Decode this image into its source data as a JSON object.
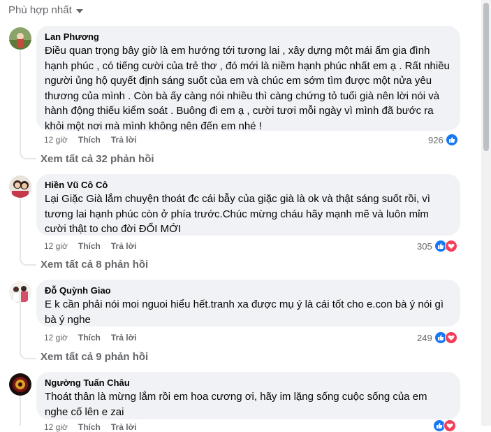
{
  "sort": {
    "label": "Phù hợp nhất"
  },
  "comments": [
    {
      "name": "Lan Phương",
      "text": "Điều quan trọng bây giờ là em hướng tới tương lai , xây dựng một mái ấm gia đình hạnh phúc , có tiếng cười của trẻ thơ , đó mới là niềm hạnh phúc nhất em ạ . Rất nhiều người ủng hộ quyết định sáng suốt của em và chúc em sớm tìm được một nửa yêu thương của mình . Còn bà ấy càng nói nhiều thì càng chứng tỏ tuổi già nên lời nói và hành động thiếu kiểm soát . Buông đi em ạ , cười tươi mỗi ngày vì mình đã bước ra khỏi một nơi mà mình không nên đến em nhé !",
      "time": "12 giờ",
      "like_label": "Thích",
      "reply_label": "Trả lời",
      "reaction_count": "926",
      "reactions": [
        "like"
      ],
      "see_replies": "Xem tất cả 32 phản hồi"
    },
    {
      "name": "Hiền Vũ Cô Cô",
      "text": "Lại Giặc Già lắm chuyện thoát đc cái bẫy của giặc già là ok và thật sáng suốt rồi, vì tương lai hạnh phúc còn ở phía trước.Chúc mừng cháu hãy mạnh mẽ và luôn mỉm cười thật to cho đời ĐỔI MỚI",
      "time": "12 giờ",
      "like_label": "Thích",
      "reply_label": "Trả lời",
      "reaction_count": "305",
      "reactions": [
        "like",
        "love"
      ],
      "see_replies": "Xem tất cả 8 phản hồi"
    },
    {
      "name": "Đỗ Quỳnh Giao",
      "text": "E k cần phải nói moi nguoi hiểu hết.tranh xa được mụ ý là cái tốt cho e.con bà ý nói gì bà ý nghe",
      "time": "12 giờ",
      "like_label": "Thích",
      "reply_label": "Trả lời",
      "reaction_count": "249",
      "reactions": [
        "like",
        "love"
      ],
      "see_replies": "Xem tất cả 9 phản hồi"
    },
    {
      "name": "Ngường Tuấn Châu",
      "text": "Thoát thân là mừng lắm rồi em hoa cương ơi, hãy im lặng sống cuộc sống của em nghe cố lên e zai",
      "time": "12 giờ",
      "like_label": "Thích",
      "reply_label": "Trả lời",
      "reaction_count": "",
      "reactions": [
        "like",
        "love"
      ],
      "see_replies": ""
    }
  ]
}
